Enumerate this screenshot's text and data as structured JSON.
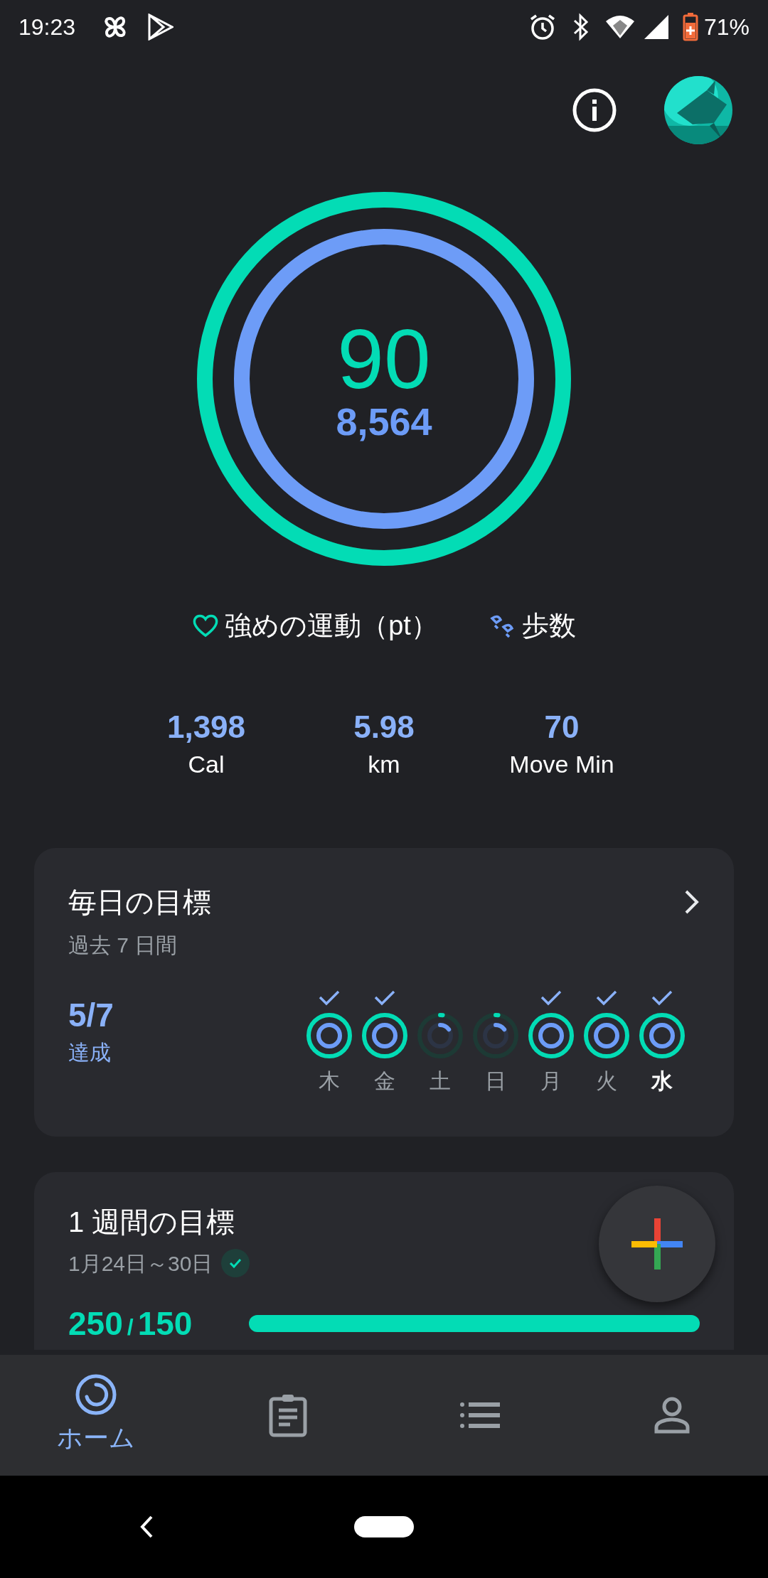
{
  "status_bar": {
    "time": "19:23",
    "battery": "71%"
  },
  "rings": {
    "heart_points": "90",
    "steps": "8,564"
  },
  "legend": [
    {
      "kind": "heart",
      "label": "強めの運動（pt）"
    },
    {
      "kind": "steps",
      "label": "歩数"
    }
  ],
  "stats": [
    {
      "value": "1,398",
      "label": "Cal"
    },
    {
      "value": "5.98",
      "label": "km"
    },
    {
      "value": "70",
      "label": "Move Min"
    }
  ],
  "daily_goals": {
    "title": "毎日の目標",
    "subtitle": "過去 7 日間",
    "count": "5/7",
    "count_label": "達成",
    "days": [
      {
        "label": "木",
        "achieved": true,
        "selected": false
      },
      {
        "label": "金",
        "achieved": true,
        "selected": false
      },
      {
        "label": "土",
        "achieved": false,
        "selected": false
      },
      {
        "label": "日",
        "achieved": false,
        "selected": false
      },
      {
        "label": "月",
        "achieved": true,
        "selected": false
      },
      {
        "label": "火",
        "achieved": true,
        "selected": false
      },
      {
        "label": "水",
        "achieved": true,
        "selected": true
      }
    ]
  },
  "weekly_goal": {
    "title": "1 週間の目標",
    "dates": "1月24日～30日",
    "done": true,
    "value": "250",
    "separator": "/",
    "goal": "150",
    "level": 1
  },
  "bottom_nav": [
    {
      "kind": "home",
      "label": "ホーム",
      "selected": true
    },
    {
      "kind": "journal",
      "selected": false
    },
    {
      "kind": "browse",
      "selected": false
    },
    {
      "kind": "profile",
      "selected": false
    }
  ]
}
